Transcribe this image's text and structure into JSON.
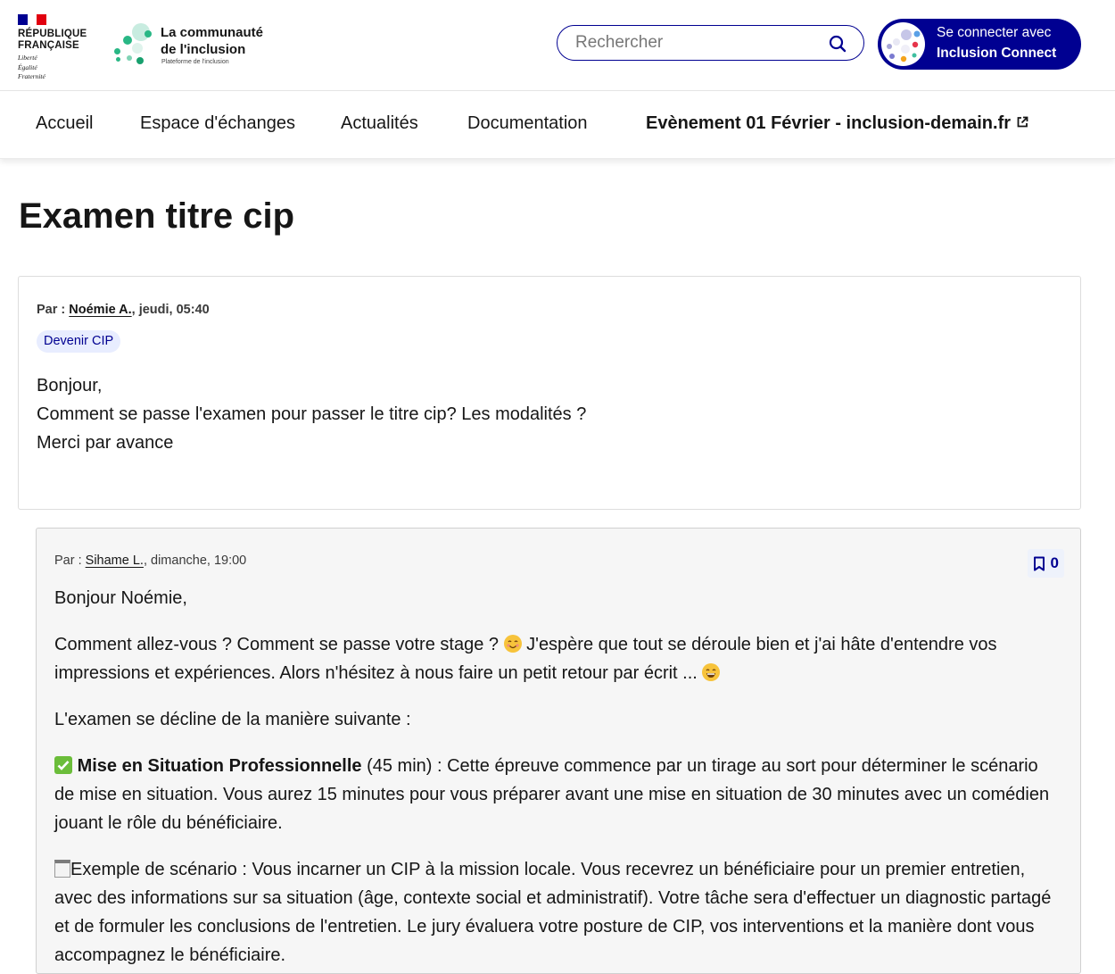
{
  "header": {
    "gov_lines": [
      "RÉPUBLIQUE",
      "FRANÇAISE"
    ],
    "gov_devise": [
      "Liberté",
      "Égalité",
      "Fraternité"
    ],
    "brand_title_line1": "La communauté",
    "brand_title_line2": "de l'inclusion",
    "brand_subtitle": "Plateforme de l'inclusion",
    "search_placeholder": "Rechercher",
    "connect_line1": "Se connecter avec",
    "connect_line2": "Inclusion Connect"
  },
  "nav": {
    "items": [
      "Accueil",
      "Espace d'échanges",
      "Actualités",
      "Documentation",
      "Evènement 01 Février - inclusion-demain.fr"
    ]
  },
  "page": {
    "title": "Examen titre cip"
  },
  "post": {
    "by_label": "Par :",
    "author": "Noémie A.",
    "date": ", jeudi, 05:40",
    "tag": "Devenir CIP",
    "lines": [
      "Bonjour,",
      "Comment se passe l'examen pour passer le titre cip? Les modalités ?",
      "Merci par avance"
    ]
  },
  "reply": {
    "by_label": "Par :",
    "author": "Sihame L.",
    "date": ", dimanche, 19:00",
    "bookmark_count": "0",
    "p1": "Bonjour Noémie,",
    "p2a": "Comment allez-vous ? Comment se passe votre stage ? ",
    "p2b": " J'espère que tout se déroule bien et j'ai hâte d'entendre vos impressions et expériences. Alors n'hésitez à nous faire un petit retour par écrit ... ",
    "p3": "L'examen se décline de la manière suivante :",
    "p4_strong": "Mise en Situation Professionnelle",
    "p4_rest": " (45 min) : Cette épreuve commence par un tirage au sort pour déterminer le scénario de mise en situation. Vous aurez 15 minutes pour vous préparer avant une mise en situation de 30 minutes avec un comédien jouant le rôle du bénéficiaire.",
    "p5": "Exemple de scénario : Vous incarner un CIP à la mission locale. Vous recevrez un bénéficiaire pour un premier entretien, avec des informations sur sa situation (âge, contexte social et administratif). Votre tâche sera d'effectuer un diagnostic partagé et de formuler les conclusions de l'entretien. Le jury évaluera votre posture de CIP, vos interventions et la manière dont vous accompagnez le bénéficiaire."
  },
  "colors": {
    "primary": "#000091",
    "flag_blue": "#000091",
    "flag_red": "#e1000f",
    "tag_bg": "#e8edff",
    "reply_bg": "#f6f6f6"
  }
}
